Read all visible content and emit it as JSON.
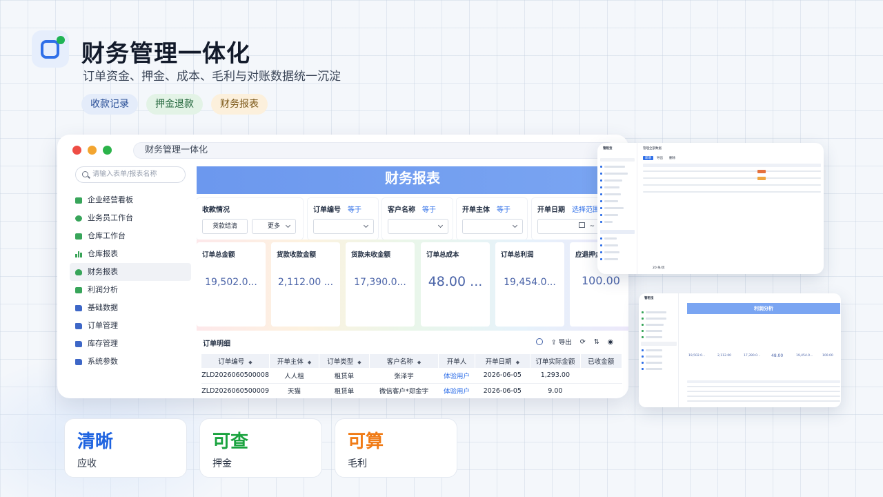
{
  "header": {
    "title": "财务管理一体化",
    "subtitle": "订单资金、押金、成本、毛利与对账数据统一沉淀",
    "tags": [
      "收款记录",
      "押金退款",
      "财务报表"
    ]
  },
  "window": {
    "url_title": "财务管理一体化",
    "search_placeholder": "请输入表单/报表名称",
    "nav": [
      "企业经营看板",
      "业务员工作台",
      "仓库工作台",
      "仓库报表",
      "财务报表",
      "利润分析",
      "基础数据",
      "订单管理",
      "库存管理",
      "系统参数"
    ],
    "banner": "财务报表",
    "filters": {
      "payment_status": {
        "label": "收款情况",
        "button1": "货款结清",
        "button2": "更多"
      },
      "order_no": {
        "label": "订单编号",
        "op": "等于"
      },
      "customer": {
        "label": "客户名称",
        "op": "等于"
      },
      "entity": {
        "label": "开单主体",
        "op": "等于"
      },
      "date": {
        "label": "开单日期",
        "op": "选择范围",
        "sep": "~"
      }
    },
    "stats": [
      {
        "label": "订单总金额",
        "value": "19,502.0..."
      },
      {
        "label": "货款收款金额",
        "value": "2,112.00 ..."
      },
      {
        "label": "货款未收金额",
        "value": "17,390.0..."
      },
      {
        "label": "订单总成本",
        "value": "48.00 ..."
      },
      {
        "label": "订单总利润",
        "value": "19,454.0..."
      },
      {
        "label": "应退押金",
        "value": "100.00"
      }
    ],
    "detail": {
      "title": "订单明细",
      "export_label": "导出",
      "columns": [
        "订单编号",
        "开单主体",
        "订单类型",
        "客户名称",
        "开单人",
        "开单日期",
        "订单实际金额",
        "已收金额"
      ],
      "rows": [
        [
          "ZLD2026060500008",
          "人人租",
          "租赁单",
          "张泽宇",
          "体验用户",
          "2026-06-05",
          "1,293.00",
          ""
        ],
        [
          "ZLD2026060500009",
          "天猫",
          "租赁单",
          "微信客户*郑金宇",
          "体验用户",
          "2026-06-05",
          "9.00",
          ""
        ]
      ]
    }
  },
  "mini1": {
    "brand": "管租宝",
    "toolbar": [
      "新增",
      "导出",
      "删除"
    ],
    "filter_hint": "管理全部数据",
    "pager_total": "20 条/页"
  },
  "mini2": {
    "brand": "管租宝",
    "banner": "利润分析",
    "values": [
      "19,502.0...",
      "2,112.00",
      "17,390.0...",
      "48.00",
      "19,454.0...",
      "100.00"
    ]
  },
  "cards": [
    {
      "big": "清晰",
      "small": "应收",
      "color": "#1e63e0"
    },
    {
      "big": "可查",
      "small": "押金",
      "color": "#1aa33f"
    },
    {
      "big": "可算",
      "small": "毛利",
      "color": "#f07b16"
    }
  ],
  "colors": {
    "accent": "#2f6fe8",
    "banner": "#7aa5f2",
    "green": "#20b455",
    "orange": "#f07b16"
  }
}
